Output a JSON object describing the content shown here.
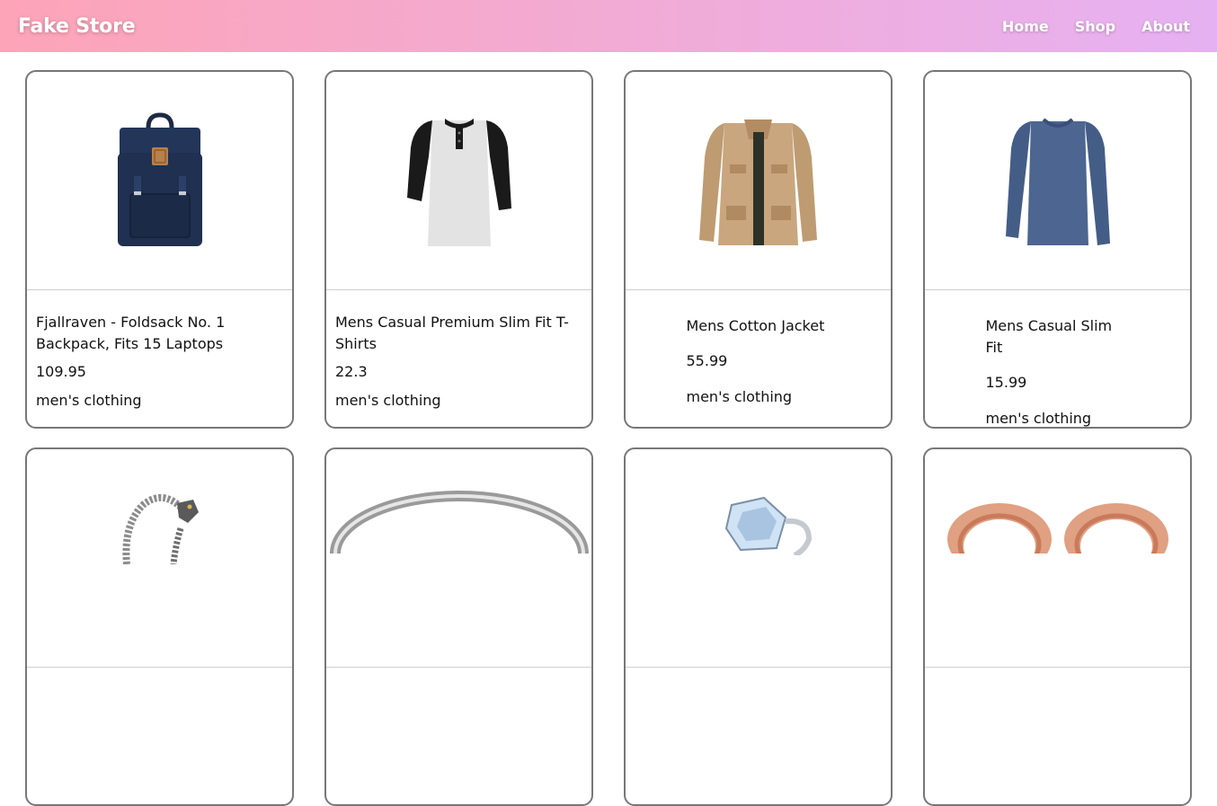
{
  "navbar": {
    "brand": "Fake Store",
    "links": [
      "Home",
      "Shop",
      "About"
    ]
  },
  "products": [
    {
      "title": "Fjallraven - Foldsack No. 1 Backpack, Fits 15 Laptops",
      "price": "109.95",
      "category": "men's clothing",
      "image": "backpack"
    },
    {
      "title": "Mens Casual Premium Slim Fit T-Shirts",
      "price": "22.3",
      "category": "men's clothing",
      "image": "raglan-shirt"
    },
    {
      "title": "Mens Cotton Jacket",
      "price": "55.99",
      "category": "men's clothing",
      "image": "cotton-jacket"
    },
    {
      "title": "Mens Casual Slim Fit",
      "price": "15.99",
      "category": "men's clothing",
      "image": "long-sleeve-shirt"
    },
    {
      "image": "dragon-bracelet"
    },
    {
      "image": "silver-ring"
    },
    {
      "image": "diamond-ring"
    },
    {
      "image": "rose-gold-tunnels"
    }
  ]
}
